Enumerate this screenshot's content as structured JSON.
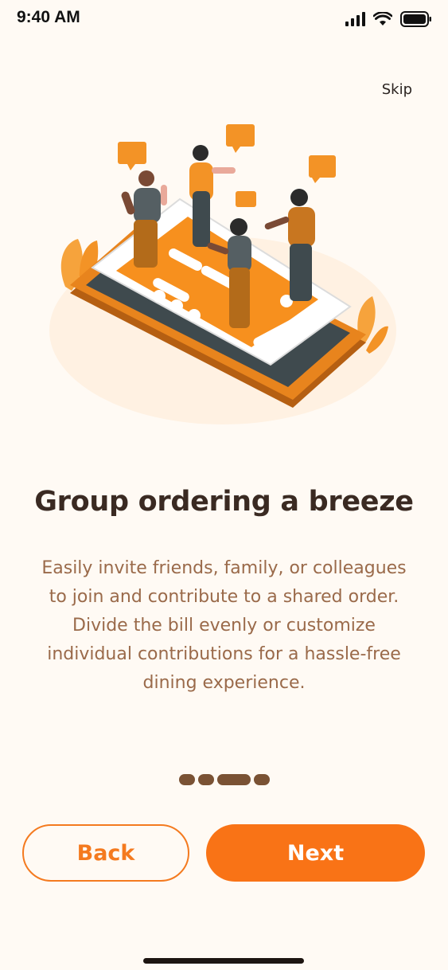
{
  "status_bar": {
    "time": "9:40 AM"
  },
  "header": {
    "skip_label": "Skip"
  },
  "onboarding": {
    "title": "Group ordering a breeze",
    "body_lines": [
      "Easily invite friends, family, or colleagues",
      "to join and contribute to a shared order.",
      "Divide the bill evenly or customize",
      "individual contributions for a hassle-free",
      "dining experience."
    ],
    "pager": {
      "total": 4,
      "active_index": 2
    }
  },
  "actions": {
    "back_label": "Back",
    "next_label": "Next"
  },
  "colors": {
    "accent": "#F97316",
    "title": "#3a2a22",
    "body": "#9a6a4a",
    "background": "#FFFAF4"
  },
  "illustration": {
    "icon": "group-ordering-illustration"
  }
}
